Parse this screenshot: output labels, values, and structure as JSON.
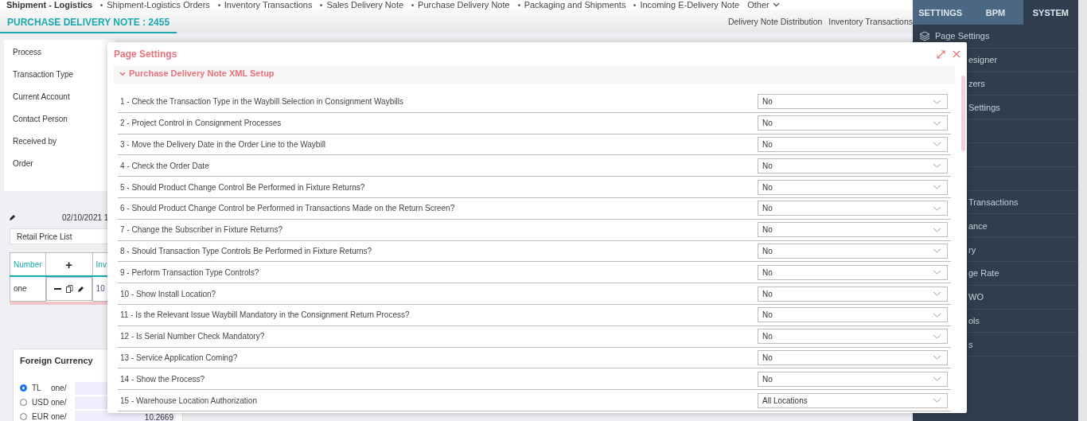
{
  "top_nav": {
    "module": "Shipment - Logistics",
    "links": [
      "Shipment-Logistics Orders",
      "Inventory Transactions",
      "Sales Delivery Note",
      "Purchase Delivery Note",
      "Packaging and Shipments",
      "Incoming E-Delivery Note"
    ],
    "more": "Other"
  },
  "header": {
    "title": "PURCHASE DELIVERY NOTE : 2455",
    "actions": [
      "Delivery Note Distribution",
      "Inventory Transactions"
    ]
  },
  "form": {
    "labels": [
      "Process",
      "Transaction Type",
      "Current Account",
      "Contact Person",
      "Received by",
      "Order"
    ],
    "date": "02/10/2021 1",
    "price_list": "Retail Price List"
  },
  "lines_table": {
    "columns": [
      "Number",
      "+",
      "Inv"
    ],
    "rows": [
      {
        "number": "one",
        "column_3": "10"
      }
    ]
  },
  "foreign_currency": {
    "title": "Foreign Currency",
    "options": [
      {
        "code": "TL",
        "unit": "one/",
        "selected": true
      },
      {
        "code": "USD",
        "unit": "one/",
        "selected": false
      },
      {
        "code": "EUR",
        "unit": "one/",
        "rate": "10.2669",
        "selected": false
      }
    ]
  },
  "side_panel": {
    "tabs": [
      {
        "label": "SETTINGS",
        "selected": false
      },
      {
        "label": "BPM",
        "selected": false
      },
      {
        "label": "SYSTEM",
        "selected": true
      }
    ],
    "items": [
      {
        "kind": "icon",
        "label": "Page Settings"
      },
      {
        "kind": "covered",
        "label": "esigner"
      },
      {
        "kind": "covered",
        "label": "zers"
      },
      {
        "kind": "covered",
        "label": "Settings"
      },
      {
        "kind": "blank"
      },
      {
        "kind": "blank"
      },
      {
        "kind": "blank"
      },
      {
        "kind": "covered",
        "label": "Transactions"
      },
      {
        "kind": "covered",
        "label": "ance"
      },
      {
        "kind": "covered",
        "label": "ry"
      },
      {
        "kind": "covered",
        "label": "ge Rate"
      },
      {
        "kind": "covered",
        "label": "WO"
      },
      {
        "kind": "covered",
        "label": "ols"
      },
      {
        "kind": "covered",
        "label": "s"
      }
    ]
  },
  "dialog": {
    "title": "Page Settings",
    "section": {
      "title": "Purchase Delivery Note XML Setup",
      "expanded": true
    },
    "settings": [
      {
        "label": "1 - Check the Transaction Type in the Waybill Selection in Consignment Waybills",
        "value": "No"
      },
      {
        "label": "2 - Project Control in Consignment Processes",
        "value": "No"
      },
      {
        "label": "3 - Move the Delivery Date in the Order Line to the Waybill",
        "value": "No"
      },
      {
        "label": "4 - Check the Order Date",
        "value": "No"
      },
      {
        "label": "5 - Should Product Change Control Be Performed in Fixture Returns?",
        "value": "No"
      },
      {
        "label": "6 - Should Product Change Control be Performed in Transactions Made on the Return Screen?",
        "value": "No"
      },
      {
        "label": "7 - Change the Subscriber in Fixture Returns?",
        "value": "No"
      },
      {
        "label": "8 - Should Transaction Type Controls Be Performed in Fixture Returns?",
        "value": "No"
      },
      {
        "label": "9 - Perform Transaction Type Controls?",
        "value": "No"
      },
      {
        "label": "10 - Show Install Location?",
        "value": "No"
      },
      {
        "label": "11 - Is the Relevant Issue Waybill Mandatory in the Consignment Return Process?",
        "value": "No"
      },
      {
        "label": "12 - Is Serial Number Check Mandatory?",
        "value": "No"
      },
      {
        "label": "13 - Service Application Coming?",
        "value": "No"
      },
      {
        "label": "14 - Show the Process?",
        "value": "No"
      },
      {
        "label": "15 - Warehouse Location Authorization",
        "value": "All Locations"
      }
    ]
  }
}
